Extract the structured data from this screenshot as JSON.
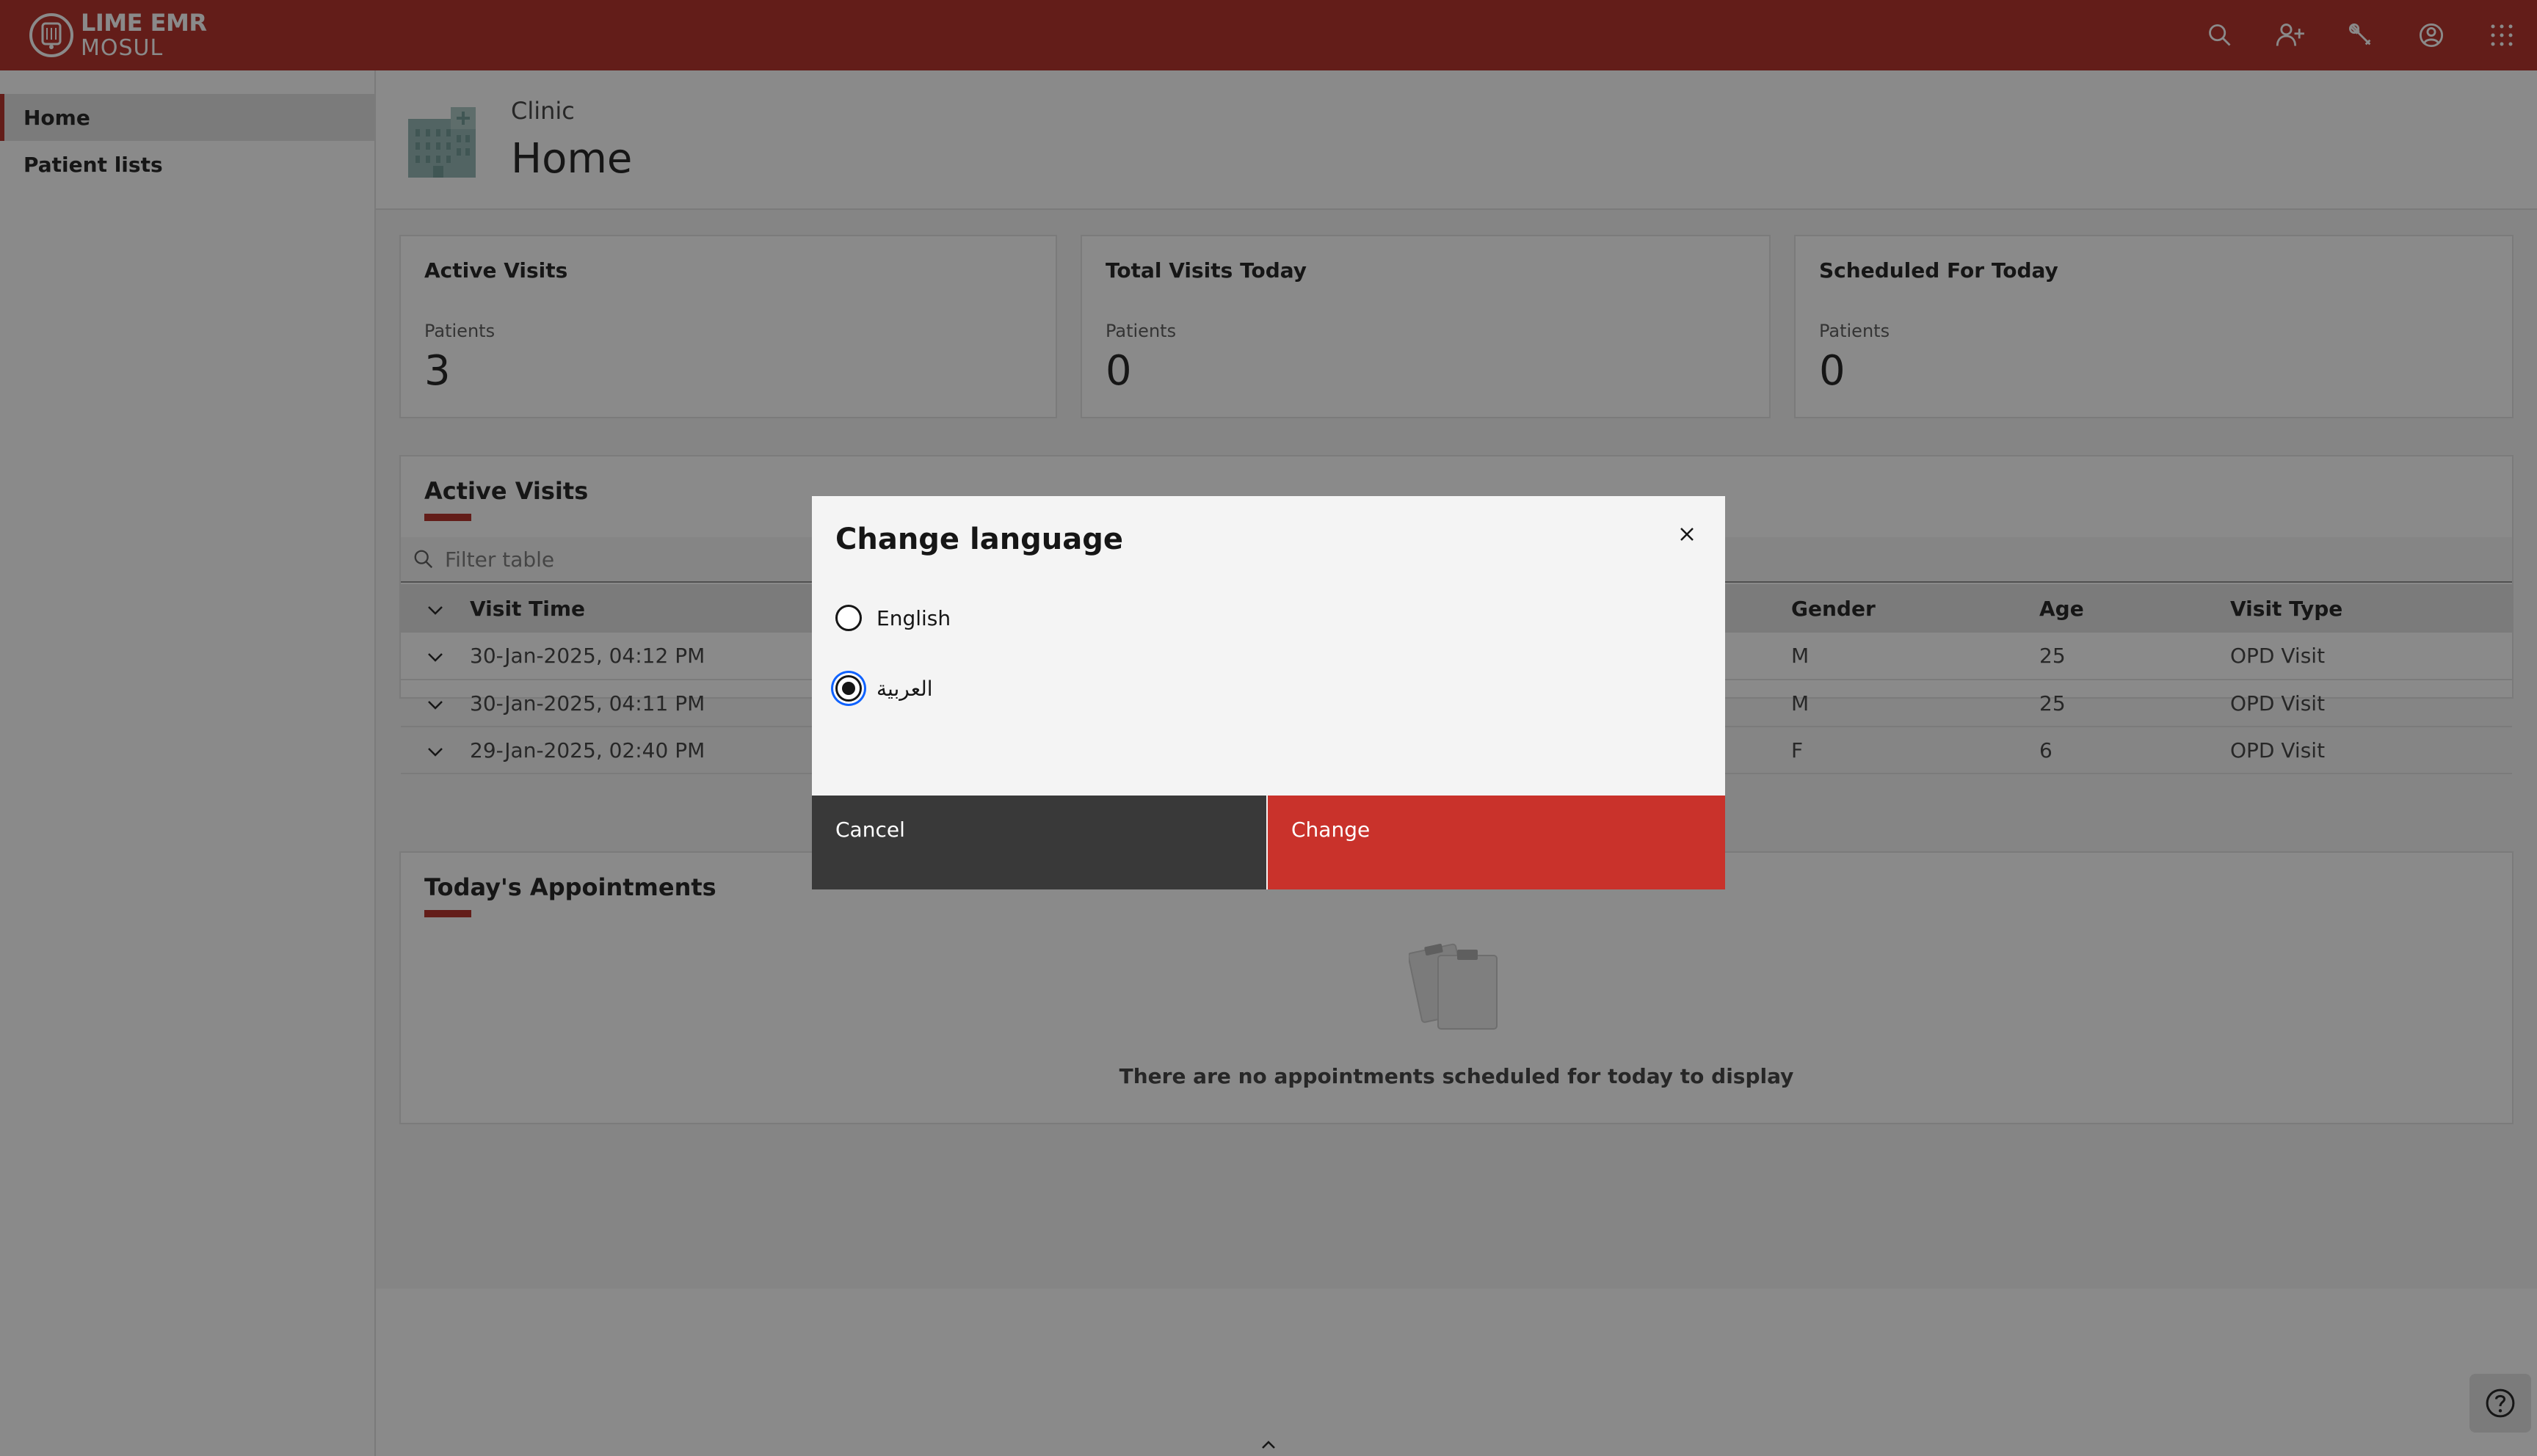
{
  "app": {
    "name": "LIME EMR",
    "location": "MOSUL",
    "accent_color": "#b0251c"
  },
  "header_actions": [
    {
      "icon": "search-icon"
    },
    {
      "icon": "add-user-icon"
    },
    {
      "icon": "wrench-icon"
    },
    {
      "icon": "user-avatar-icon"
    },
    {
      "icon": "app-switcher-icon"
    }
  ],
  "sidebar": {
    "items": [
      {
        "label": "Home",
        "active": true
      },
      {
        "label": "Patient lists",
        "active": false
      }
    ]
  },
  "page": {
    "subtitle": "Clinic",
    "title": "Home"
  },
  "tiles": [
    {
      "title": "Active Visits",
      "label": "Patients",
      "value": "3"
    },
    {
      "title": "Total Visits Today",
      "label": "Patients",
      "value": "0"
    },
    {
      "title": "Scheduled For Today",
      "label": "Patients",
      "value": "0"
    }
  ],
  "active_visits": {
    "title": "Active Visits",
    "search_placeholder": "Filter table",
    "columns": {
      "visit_time": "Visit Time",
      "gender": "Gender",
      "age": "Age",
      "visit_type": "Visit Type"
    },
    "rows": [
      {
        "visit_time": "30-Jan-2025, 04:12 PM",
        "gender": "M",
        "age": "25",
        "visit_type": "OPD Visit"
      },
      {
        "visit_time": "30-Jan-2025, 04:11 PM",
        "gender": "M",
        "age": "25",
        "visit_type": "OPD Visit"
      },
      {
        "visit_time": "29-Jan-2025, 02:40 PM",
        "gender": "F",
        "age": "6",
        "visit_type": "OPD Visit"
      }
    ]
  },
  "appointments": {
    "title": "Today's Appointments",
    "empty_message": "There are no appointments scheduled for today to display"
  },
  "modal": {
    "title": "Change language",
    "options": [
      {
        "label": "English",
        "selected": false
      },
      {
        "label": "العربية",
        "selected": true
      }
    ],
    "cancel_label": "Cancel",
    "confirm_label": "Change",
    "confirm_color": "#da1e28"
  }
}
